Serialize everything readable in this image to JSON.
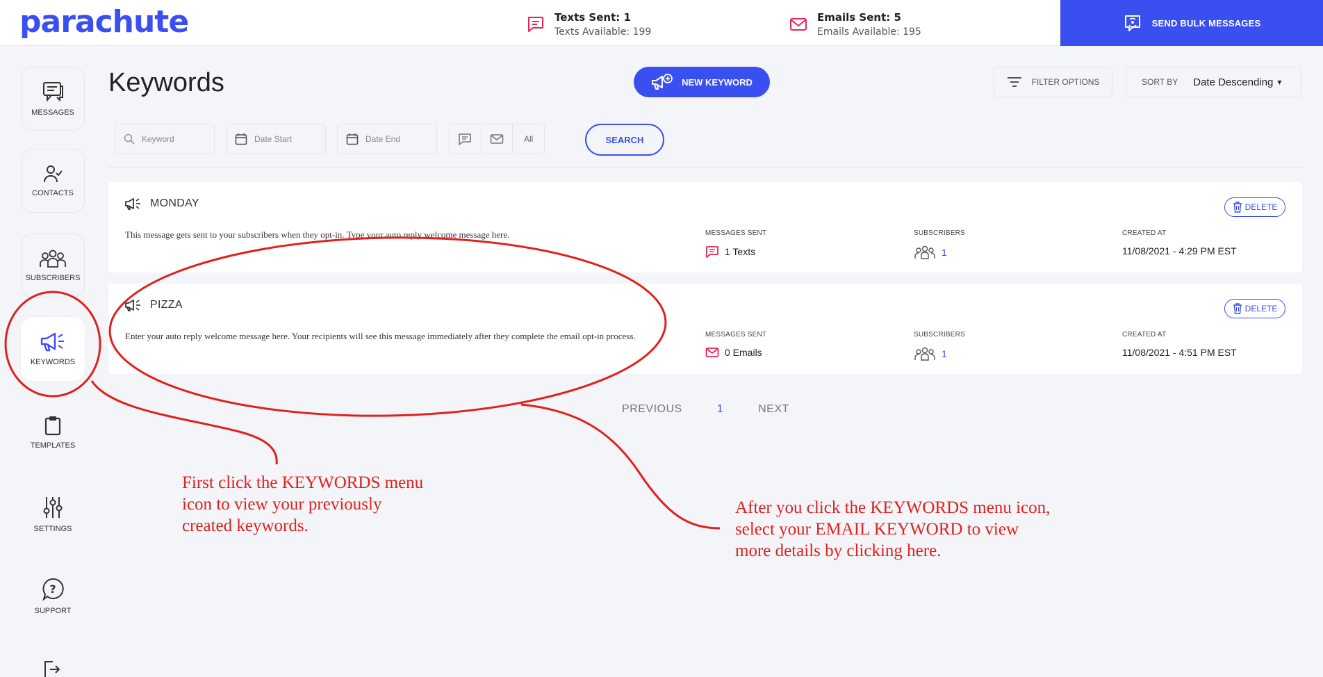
{
  "brand": {
    "logo_text": "parachute",
    "accent": "#3a4ff0",
    "alert": "#e8245b"
  },
  "stats": {
    "texts": {
      "sent": "Texts Sent: 1",
      "available": "Texts Available: 199",
      "icon": "chat-icon"
    },
    "emails": {
      "sent": "Emails Sent: 5",
      "available": "Emails Available: 195",
      "icon": "mail-icon"
    }
  },
  "header": {
    "bulk_label": "SEND BULK MESSAGES"
  },
  "sidebar": {
    "items": [
      {
        "label": "MESSAGES",
        "icon": "messages-icon"
      },
      {
        "label": "CONTACTS",
        "icon": "contacts-icon"
      },
      {
        "label": "SUBSCRIBERS",
        "icon": "subscribers-icon"
      },
      {
        "label": "KEYWORDS",
        "icon": "megaphone-icon",
        "active": true
      },
      {
        "label": "TEMPLATES",
        "icon": "clipboard-icon"
      },
      {
        "label": "SETTINGS",
        "icon": "sliders-icon"
      },
      {
        "label": "SUPPORT",
        "icon": "help-icon"
      }
    ]
  },
  "main": {
    "title": "Keywords",
    "new_keyword_label": "NEW KEYWORD",
    "filter_label": "FILTER OPTIONS",
    "sort": {
      "label": "SORT BY",
      "value": "Date Descending"
    }
  },
  "filters": {
    "keyword_placeholder": "Keyword",
    "date_start_placeholder": "Date Start",
    "date_end_placeholder": "Date End",
    "channel_all": "All",
    "search_label": "SEARCH"
  },
  "columns": {
    "messages_sent": "MESSAGES SENT",
    "subscribers": "SUBSCRIBERS",
    "created_at": "CREATED AT"
  },
  "keywords": [
    {
      "name": "MONDAY",
      "description": "This message gets sent to your subscribers when they opt-in. Type your auto reply welcome message here.",
      "messages_sent": "1 Texts",
      "channel": "text",
      "subscribers": "1",
      "created_at": "11/08/2021 - 4:29 PM EST",
      "delete_label": "DELETE"
    },
    {
      "name": "PIZZA",
      "description": "Enter your auto reply welcome message here. Your recipients will see this message immediately after they complete the email opt-in process.",
      "messages_sent": "0 Emails",
      "channel": "email",
      "subscribers": "1",
      "created_at": "11/08/2021 - 4:51 PM EST",
      "delete_label": "DELETE"
    }
  ],
  "pagination": {
    "previous": "PREVIOUS",
    "current": "1",
    "next": "NEXT"
  },
  "annotations": {
    "first": "First click the KEYWORDS menu icon to view your previously created keywords.",
    "second": "After you click the KEYWORDS menu icon, select your EMAIL KEYWORD to view more details by clicking here."
  }
}
